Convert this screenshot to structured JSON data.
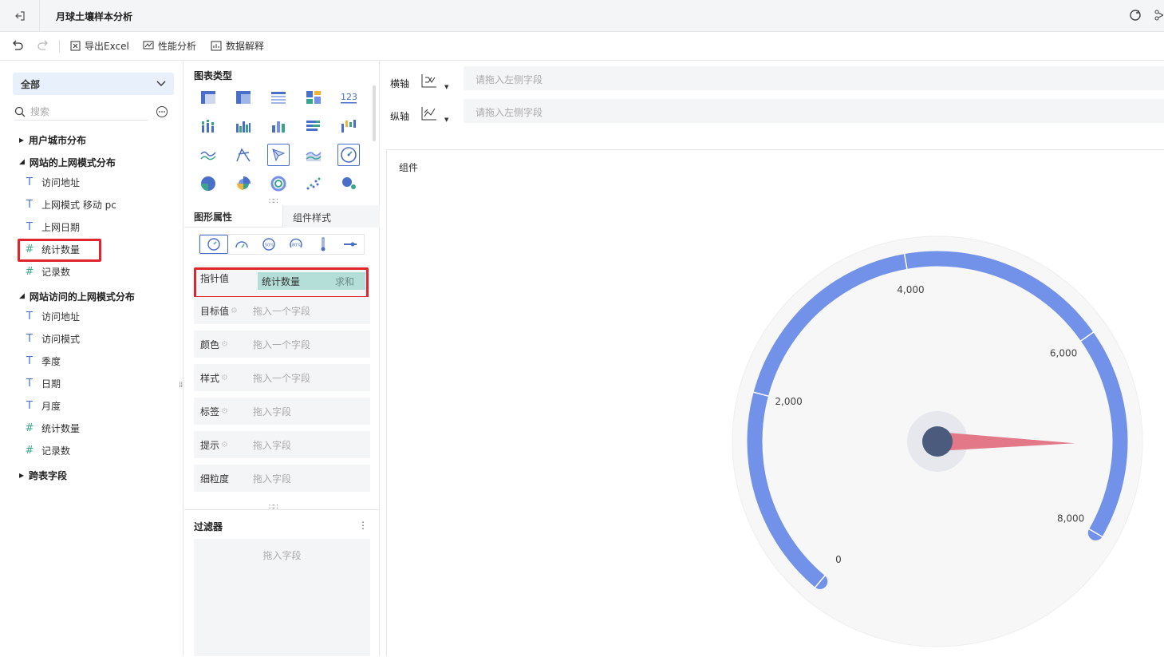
{
  "header": {
    "title": "月球土壤样本分析"
  },
  "toolbar": {
    "export_label": "导出Excel",
    "perf_label": "性能分析",
    "explain_label": "数据解释"
  },
  "left_panel": {
    "selector": "全部",
    "search_placeholder": "搜索",
    "groups": [
      {
        "label": "用户城市分布",
        "expanded": false,
        "fields": []
      },
      {
        "label": "网站的上网模式分布",
        "expanded": true,
        "fields": [
          {
            "type": "T",
            "label": "访问地址"
          },
          {
            "type": "T",
            "label": "上网模式 移动 pc"
          },
          {
            "type": "T",
            "label": "上网日期"
          },
          {
            "type": "#",
            "label": "统计数量"
          },
          {
            "type": "#",
            "label": "记录数"
          }
        ]
      },
      {
        "label": "网站访问的上网模式分布",
        "expanded": true,
        "fields": [
          {
            "type": "T",
            "label": "访问地址"
          },
          {
            "type": "T",
            "label": "访问模式"
          },
          {
            "type": "T",
            "label": "季度"
          },
          {
            "type": "T",
            "label": "日期"
          },
          {
            "type": "T",
            "label": "月度"
          },
          {
            "type": "#",
            "label": "统计数量"
          },
          {
            "type": "#",
            "label": "记录数"
          }
        ]
      },
      {
        "label": "跨表字段",
        "expanded": false,
        "fields": []
      }
    ]
  },
  "mid_panel": {
    "chart_type_title": "图表类型",
    "tabs": [
      "图形属性",
      "组件样式"
    ],
    "props": [
      {
        "label": "指针值",
        "field": "统计数量",
        "agg": "求和"
      },
      {
        "label": "目标值",
        "placeholder": "拖入一个字段"
      },
      {
        "label": "颜色",
        "placeholder": "拖入一个字段"
      },
      {
        "label": "样式",
        "placeholder": "拖入一个字段"
      },
      {
        "label": "标签",
        "placeholder": "拖入字段"
      },
      {
        "label": "提示",
        "placeholder": "拖入字段"
      },
      {
        "label": "细粒度",
        "placeholder": "拖入字段"
      }
    ],
    "filter_title": "过滤器",
    "filter_placeholder": "拖入字段"
  },
  "axes": {
    "x_label": "横轴",
    "y_label": "纵轴",
    "x_placeholder": "请拖入左侧字段",
    "y_placeholder": "请拖入左侧字段"
  },
  "canvas": {
    "caption": "组件"
  },
  "gauge": {
    "min": 0,
    "max": 8000,
    "value": 7100,
    "tick_labels": [
      "0",
      "2,000",
      "4,000",
      "6,000",
      "8,000"
    ],
    "colors": {
      "arc": "#7292ea",
      "pointer": "#e27888",
      "hub": "#4a5b7d",
      "face": "#f7f7f8"
    }
  },
  "colors": {
    "accent": "#4a6fc8",
    "highlight": "#e0262c",
    "pill": "#b3dfd8"
  }
}
